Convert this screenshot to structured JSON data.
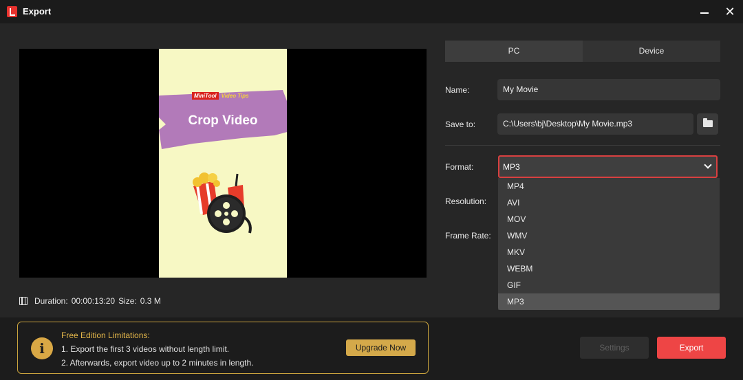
{
  "window": {
    "title": "Export",
    "close_glyph": "✕"
  },
  "preview": {
    "brand_mini": "MiniTool",
    "brand_tips": "Video Tips",
    "banner_title": "Crop Video"
  },
  "meta": {
    "duration_label": "Duration:",
    "duration_value": "00:00:13:20",
    "size_label": "Size:",
    "size_value": "0.3 M"
  },
  "tabs": [
    {
      "label": "PC",
      "active": true
    },
    {
      "label": "Device",
      "active": false
    }
  ],
  "form": {
    "name_label": "Name:",
    "name_value": "My Movie",
    "save_label": "Save to:",
    "save_value": "C:\\Users\\bj\\Desktop\\My Movie.mp3",
    "format_label": "Format:",
    "format_value": "MP3",
    "resolution_label": "Resolution:",
    "framerate_label": "Frame Rate:"
  },
  "format_options": [
    "MP4",
    "AVI",
    "MOV",
    "WMV",
    "MKV",
    "WEBM",
    "GIF",
    "MP3"
  ],
  "limits": {
    "title": "Free Edition Limitations:",
    "line1": "1. Export the first 3 videos without length limit.",
    "line2": "2. Afterwards, export video up to 2 minutes in length.",
    "info_glyph": "i",
    "upgrade_label": "Upgrade Now"
  },
  "footer": {
    "settings_label": "Settings",
    "export_label": "Export"
  },
  "colors": {
    "accent_red": "#ee4545",
    "warning_gold": "#d4a94a",
    "preview_bg": "#f7f8c4",
    "banner_purple": "#b27ab9"
  },
  "icons": [
    "app-logo-icon",
    "minimize-icon",
    "close-icon",
    "film-icon",
    "folder-icon",
    "chevron-down-icon",
    "info-icon"
  ]
}
